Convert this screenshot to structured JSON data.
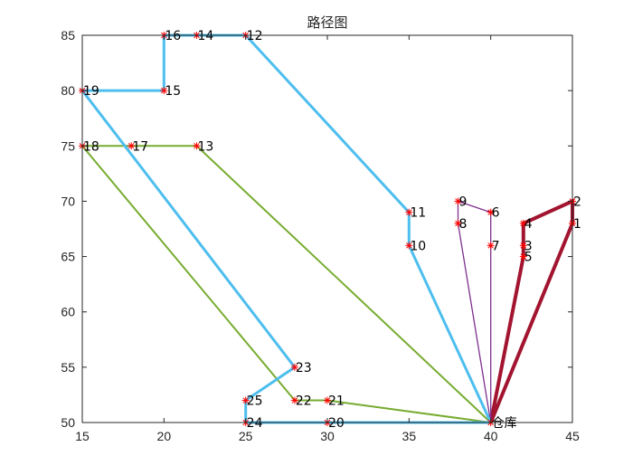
{
  "chart_data": {
    "type": "line",
    "title": "路径图",
    "xlabel": "",
    "ylabel": "",
    "xlim": [
      15,
      45
    ],
    "ylim": [
      50,
      85
    ],
    "xticks": [
      15,
      20,
      25,
      30,
      35,
      40,
      45
    ],
    "yticks": [
      50,
      55,
      60,
      65,
      70,
      75,
      80,
      85
    ],
    "grid": false,
    "legend": "none",
    "marker": "*",
    "marker_color": "#ff0000",
    "nodes": [
      {
        "label": "仓库",
        "x": 40,
        "y": 50
      },
      {
        "label": "1",
        "x": 45,
        "y": 68
      },
      {
        "label": "2",
        "x": 45,
        "y": 70
      },
      {
        "label": "3",
        "x": 42,
        "y": 66
      },
      {
        "label": "4",
        "x": 42,
        "y": 68
      },
      {
        "label": "5",
        "x": 42,
        "y": 65
      },
      {
        "label": "6",
        "x": 40,
        "y": 69
      },
      {
        "label": "7",
        "x": 40,
        "y": 66
      },
      {
        "label": "8",
        "x": 38,
        "y": 68
      },
      {
        "label": "9",
        "x": 38,
        "y": 70
      },
      {
        "label": "10",
        "x": 35,
        "y": 66
      },
      {
        "label": "11",
        "x": 35,
        "y": 69
      },
      {
        "label": "12",
        "x": 25,
        "y": 85
      },
      {
        "label": "13",
        "x": 22,
        "y": 75
      },
      {
        "label": "14",
        "x": 22,
        "y": 85
      },
      {
        "label": "15",
        "x": 20,
        "y": 80
      },
      {
        "label": "16",
        "x": 20,
        "y": 85
      },
      {
        "label": "17",
        "x": 18,
        "y": 75
      },
      {
        "label": "18",
        "x": 15,
        "y": 75
      },
      {
        "label": "19",
        "x": 15,
        "y": 80
      },
      {
        "label": "20",
        "x": 30,
        "y": 50
      },
      {
        "label": "21",
        "x": 30,
        "y": 52
      },
      {
        "label": "22",
        "x": 28,
        "y": 52
      },
      {
        "label": "23",
        "x": 28,
        "y": 55
      },
      {
        "label": "24",
        "x": 25,
        "y": 50
      },
      {
        "label": "25",
        "x": 25,
        "y": 52
      }
    ],
    "series": [
      {
        "color": "#a2142f",
        "width": 4,
        "x": [
          40,
          45,
          45,
          42,
          42,
          42,
          40
        ],
        "y": [
          50,
          68,
          70,
          68,
          66,
          65,
          50
        ]
      },
      {
        "color": "#7e2f8e",
        "width": 1.3,
        "x": [
          40,
          40,
          40,
          38,
          38,
          40
        ],
        "y": [
          50,
          66,
          69,
          70,
          68,
          50
        ]
      },
      {
        "color": "#77ac30",
        "width": 2,
        "x": [
          40,
          22,
          18,
          15,
          28,
          30,
          40
        ],
        "y": [
          50,
          75,
          75,
          75,
          52,
          52,
          50
        ]
      },
      {
        "color": "#4dbeee",
        "width": 3,
        "x": [
          40,
          35,
          35,
          25,
          22,
          20,
          20,
          15,
          28,
          25,
          25,
          30,
          40
        ],
        "y": [
          50,
          66,
          69,
          85,
          85,
          85,
          80,
          80,
          55,
          52,
          50,
          50,
          50
        ]
      }
    ]
  }
}
